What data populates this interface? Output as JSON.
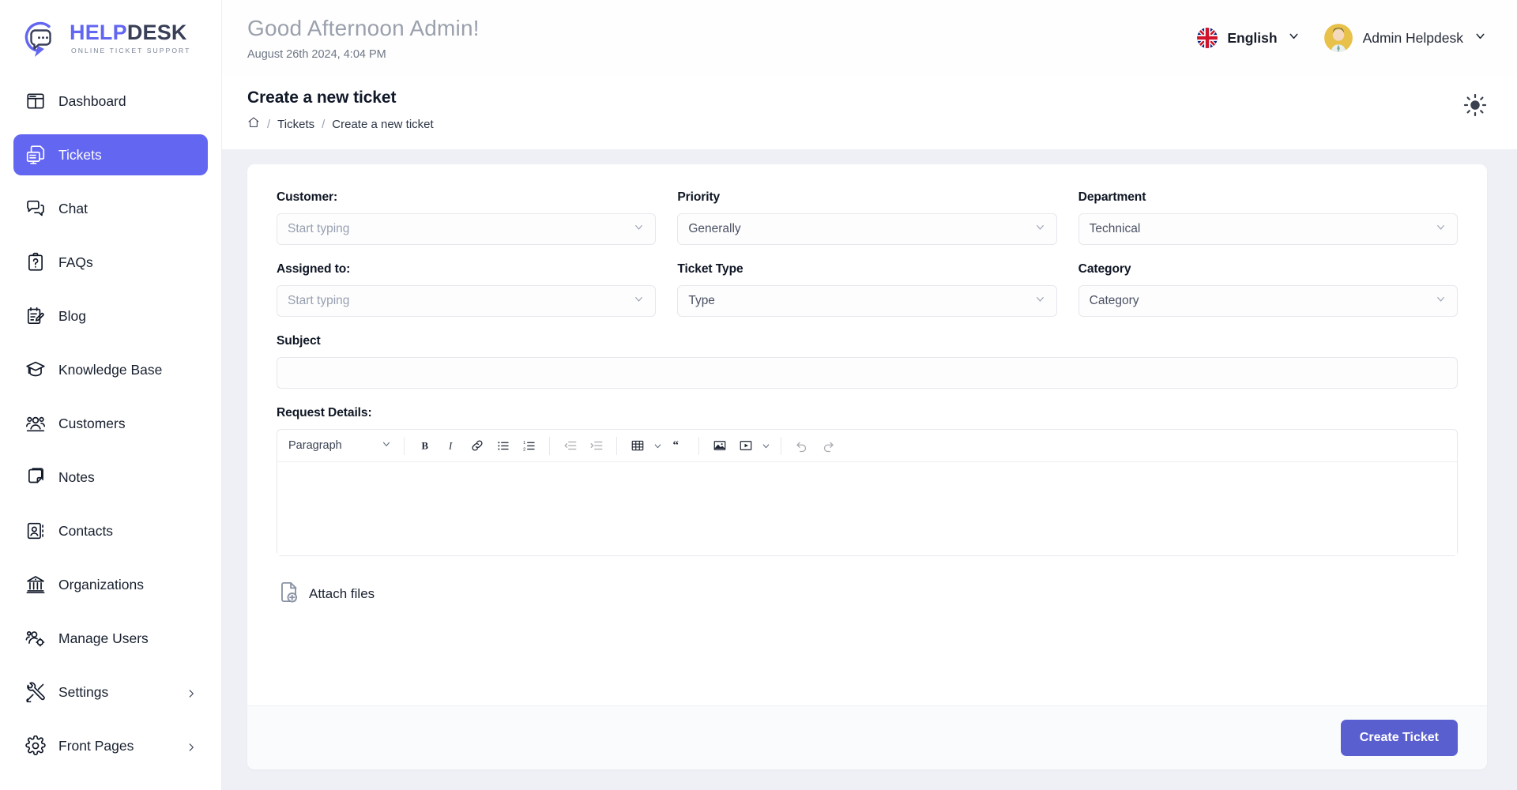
{
  "brand": {
    "name_help": "HELP",
    "name_desk": "DESK",
    "tagline": "ONLINE TICKET SUPPORT",
    "accent": "#6366f1",
    "dark": "#383f57"
  },
  "sidebar": {
    "items": [
      {
        "label": "Dashboard",
        "icon": "dashboard-icon",
        "active": false,
        "expandable": false
      },
      {
        "label": "Tickets",
        "icon": "tickets-icon",
        "active": true,
        "expandable": false
      },
      {
        "label": "Chat",
        "icon": "chat-icon",
        "active": false,
        "expandable": false
      },
      {
        "label": "FAQs",
        "icon": "faqs-icon",
        "active": false,
        "expandable": false
      },
      {
        "label": "Blog",
        "icon": "blog-icon",
        "active": false,
        "expandable": false
      },
      {
        "label": "Knowledge Base",
        "icon": "knowledge-base-icon",
        "active": false,
        "expandable": false
      },
      {
        "label": "Customers",
        "icon": "customers-icon",
        "active": false,
        "expandable": false
      },
      {
        "label": "Notes",
        "icon": "notes-icon",
        "active": false,
        "expandable": false
      },
      {
        "label": "Contacts",
        "icon": "contacts-icon",
        "active": false,
        "expandable": false
      },
      {
        "label": "Organizations",
        "icon": "organizations-icon",
        "active": false,
        "expandable": false
      },
      {
        "label": "Manage Users",
        "icon": "manage-users-icon",
        "active": false,
        "expandable": false
      },
      {
        "label": "Settings",
        "icon": "settings-icon",
        "active": false,
        "expandable": true
      },
      {
        "label": "Front Pages",
        "icon": "front-pages-icon",
        "active": false,
        "expandable": true
      }
    ]
  },
  "topbar": {
    "greeting": "Good Afternoon Admin!",
    "datetime": "August 26th 2024, 4:04 PM",
    "language": "English",
    "user_name": "Admin Helpdesk"
  },
  "page": {
    "title": "Create a new ticket",
    "breadcrumb": {
      "home_icon": "home-icon",
      "items": [
        "Tickets",
        "Create a new ticket"
      ],
      "separator": "/"
    },
    "theme_icon": "sun-icon"
  },
  "form": {
    "fields": [
      {
        "label": "Customer:",
        "value": "Start typing",
        "placeholder": true,
        "name": "customer"
      },
      {
        "label": "Priority",
        "value": "Generally",
        "placeholder": false,
        "name": "priority"
      },
      {
        "label": "Department",
        "value": "Technical",
        "placeholder": false,
        "name": "department"
      },
      {
        "label": "Assigned to:",
        "value": "Start typing",
        "placeholder": true,
        "name": "assigned-to"
      },
      {
        "label": "Ticket Type",
        "value": "Type",
        "placeholder": false,
        "name": "ticket-type"
      },
      {
        "label": "Category",
        "value": "Category",
        "placeholder": false,
        "name": "category"
      }
    ],
    "subject": {
      "label": "Subject",
      "value": "",
      "placeholder": ""
    },
    "request_details": {
      "label": "Request Details:"
    },
    "attach": {
      "label": "Attach files",
      "icon": "file-add-icon"
    },
    "submit": {
      "label": "Create Ticket",
      "color": "#5a5fd0"
    }
  },
  "editor": {
    "block_format": "Paragraph",
    "tools": [
      {
        "name": "bold-icon",
        "title": "B"
      },
      {
        "name": "italic-icon",
        "title": "I"
      },
      {
        "name": "link-icon",
        "title": "Link"
      },
      {
        "name": "bullet-list-icon",
        "title": "Bulleted list"
      },
      {
        "name": "numbered-list-icon",
        "title": "Numbered list"
      },
      {
        "name": "outdent-icon",
        "title": "Decrease indent"
      },
      {
        "name": "indent-icon",
        "title": "Increase indent"
      },
      {
        "name": "table-icon",
        "title": "Table"
      },
      {
        "name": "blockquote-icon",
        "title": "Block quote"
      },
      {
        "name": "image-icon",
        "title": "Insert image"
      },
      {
        "name": "media-icon",
        "title": "Insert media"
      },
      {
        "name": "undo-icon",
        "title": "Undo"
      },
      {
        "name": "redo-icon",
        "title": "Redo"
      }
    ]
  }
}
